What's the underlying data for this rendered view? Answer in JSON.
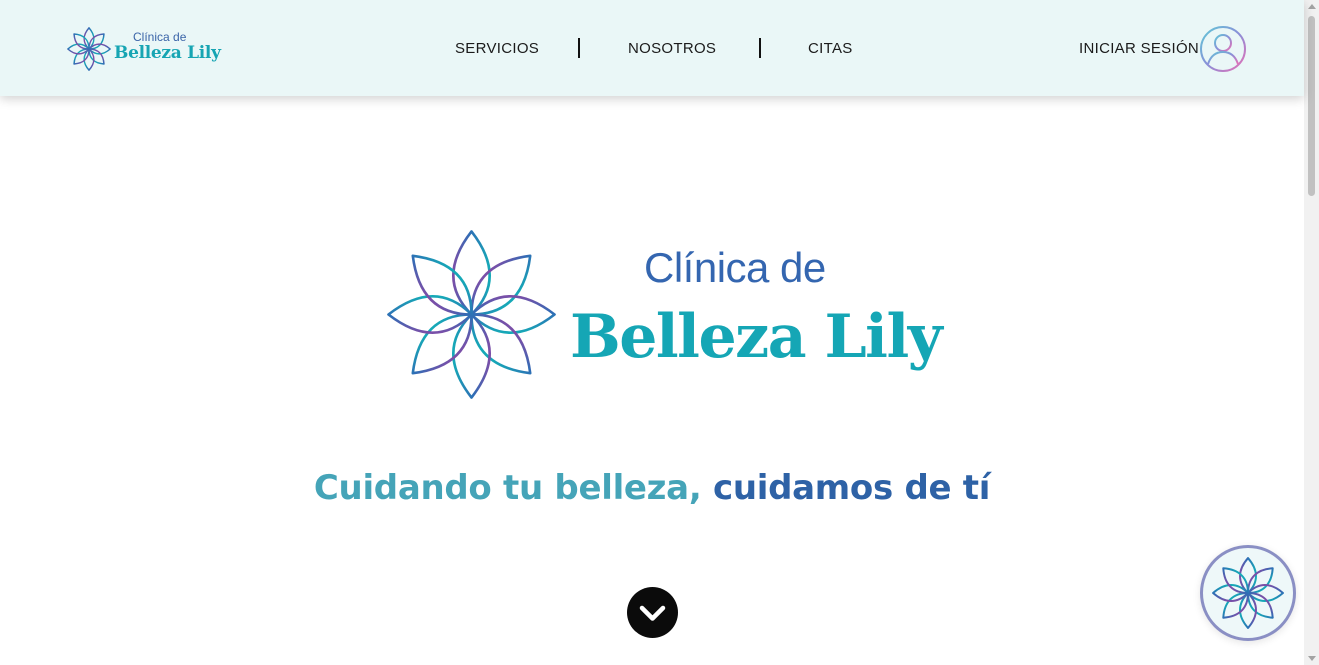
{
  "brand": {
    "line1": "Clínica de",
    "line2": "Belleza Lily"
  },
  "nav": {
    "items": [
      {
        "label": "SERVICIOS"
      },
      {
        "label": "NOSOTROS"
      },
      {
        "label": "CITAS"
      }
    ]
  },
  "login": {
    "label": "INICIAR SESIÓN"
  },
  "hero": {
    "line1": "Clínica de",
    "line2": "Belleza Lily",
    "tagline_part1": "Cuidando tu belleza,",
    "tagline_part2": "cuidamos de tí"
  },
  "icons": {
    "logo": "lotus-flower-icon",
    "avatar": "user-avatar-icon",
    "scroll": "chevron-down-icon",
    "chat": "lotus-chat-icon"
  },
  "colors": {
    "header_bg": "#eaf7f7",
    "brand_blue": "#3466b0",
    "brand_teal": "#15a6b5",
    "tagline_teal": "#45a4b8",
    "tagline_blue": "#2e62a6",
    "purple": "#7a4fa8"
  }
}
